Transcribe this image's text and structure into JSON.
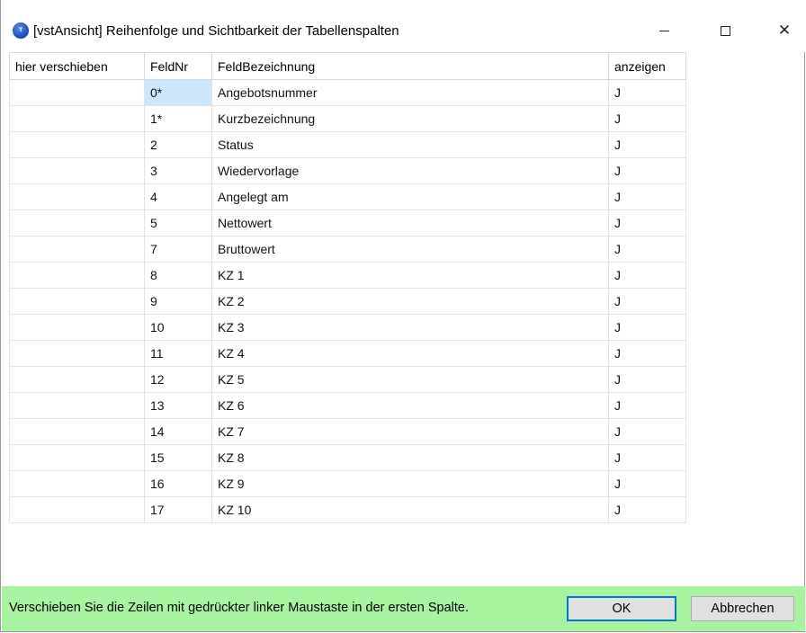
{
  "window": {
    "title": "[vstAnsicht] Reihenfolge und Sichtbarkeit der Tabellenspalten",
    "icon_text": "T SHK",
    "icon_name": "app-logo-icon"
  },
  "grid": {
    "headers": [
      "hier verschieben",
      "FeldNr",
      "FeldBezeichnung",
      "anzeigen"
    ],
    "rows": [
      {
        "move": "",
        "nr": "0*",
        "name": "Angebotsnummer",
        "show": "J"
      },
      {
        "move": "",
        "nr": "1*",
        "name": "Kurzbezeichnung",
        "show": "J"
      },
      {
        "move": "",
        "nr": "2",
        "name": "Status",
        "show": "J"
      },
      {
        "move": "",
        "nr": "3",
        "name": "Wiedervorlage",
        "show": "J"
      },
      {
        "move": "",
        "nr": "4",
        "name": "Angelegt am",
        "show": "J"
      },
      {
        "move": "",
        "nr": "5",
        "name": "Nettowert",
        "show": "J"
      },
      {
        "move": "",
        "nr": "7",
        "name": "Bruttowert",
        "show": "J"
      },
      {
        "move": "",
        "nr": "8",
        "name": "KZ 1",
        "show": "J"
      },
      {
        "move": "",
        "nr": "9",
        "name": "KZ 2",
        "show": "J"
      },
      {
        "move": "",
        "nr": "10",
        "name": "KZ 3",
        "show": "J"
      },
      {
        "move": "",
        "nr": "11",
        "name": "KZ 4",
        "show": "J"
      },
      {
        "move": "",
        "nr": "12",
        "name": "KZ 5",
        "show": "J"
      },
      {
        "move": "",
        "nr": "13",
        "name": "KZ 6",
        "show": "J"
      },
      {
        "move": "",
        "nr": "14",
        "name": "KZ 7",
        "show": "J"
      },
      {
        "move": "",
        "nr": "15",
        "name": "KZ 8",
        "show": "J"
      },
      {
        "move": "",
        "nr": "16",
        "name": "KZ 9",
        "show": "J"
      },
      {
        "move": "",
        "nr": "17",
        "name": "KZ 10",
        "show": "J"
      }
    ],
    "selected_row_index": 0,
    "selection_color": "#cce8ff"
  },
  "footer": {
    "message": "Verschieben Sie die Zeilen mit gedrückter linker Maustaste in der ersten Spalte.",
    "ok_label": "OK",
    "cancel_label": "Abbrechen",
    "background_color": "#a8f3a0",
    "focus_color": "#0078d7"
  }
}
